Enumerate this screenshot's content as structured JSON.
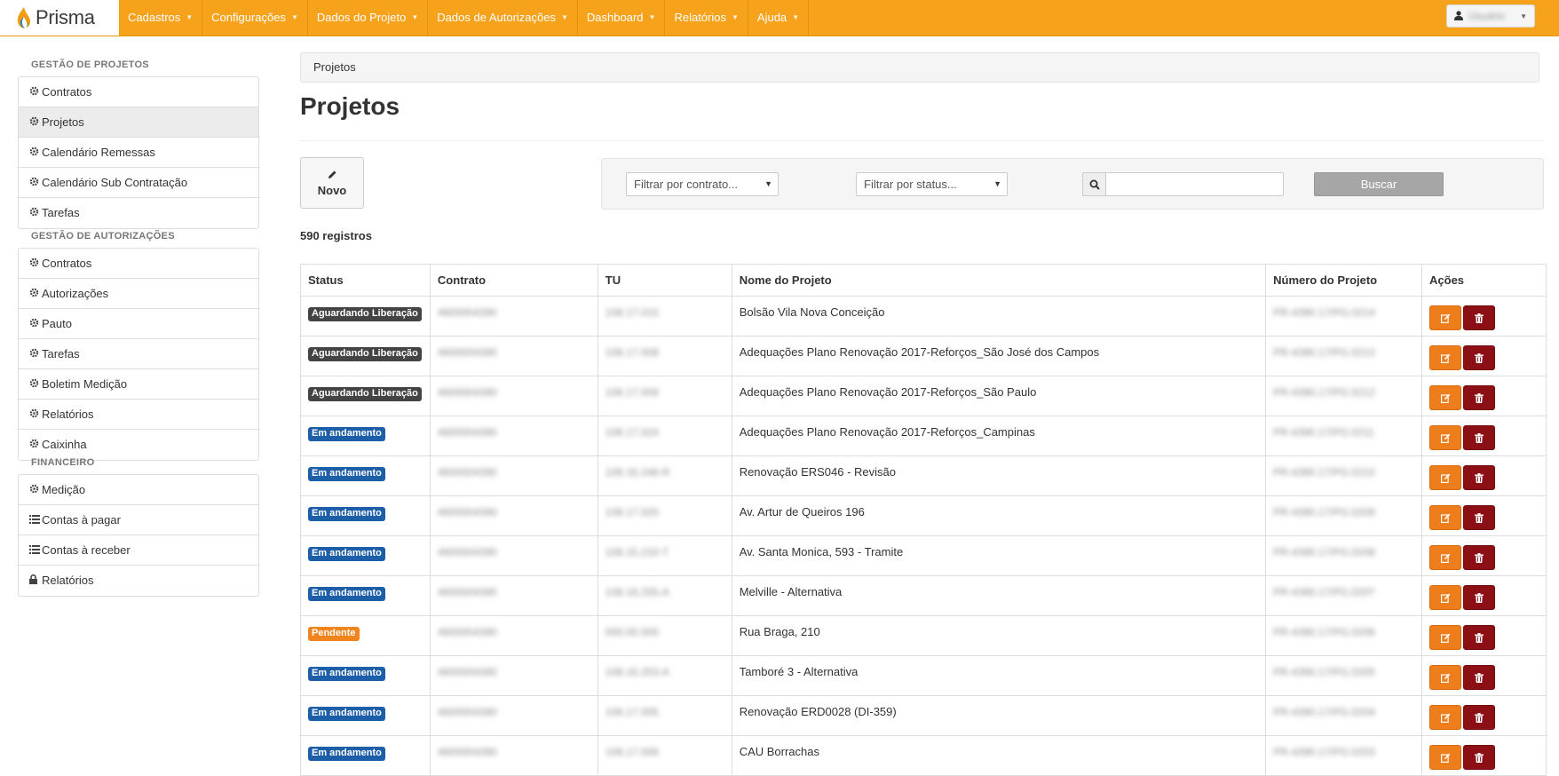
{
  "brand": {
    "name": "Prisma"
  },
  "nav": [
    {
      "label": "Cadastros"
    },
    {
      "label": "Configurações"
    },
    {
      "label": "Dados do Projeto"
    },
    {
      "label": "Dados de Autorizações"
    },
    {
      "label": "Dashboard"
    },
    {
      "label": "Relatórios"
    },
    {
      "label": "Ajuda"
    }
  ],
  "user": {
    "name": "Usuário"
  },
  "sidebar": {
    "sections": [
      {
        "title": "GESTÃO DE PROJETOS",
        "items": [
          {
            "label": "Contratos",
            "icon": "gear-icon"
          },
          {
            "label": "Projetos",
            "icon": "gear-icon"
          },
          {
            "label": "Calendário Remessas",
            "icon": "gear-icon"
          },
          {
            "label": "Calendário Sub Contratação",
            "icon": "gear-icon"
          },
          {
            "label": "Tarefas",
            "icon": "gear-icon"
          }
        ]
      },
      {
        "title": "GESTÃO DE AUTORIZAÇÕES",
        "items": [
          {
            "label": "Contratos",
            "icon": "gear-icon"
          },
          {
            "label": "Autorizações",
            "icon": "gear-icon"
          },
          {
            "label": "Pauto",
            "icon": "gear-icon"
          },
          {
            "label": "Tarefas",
            "icon": "gear-icon"
          },
          {
            "label": "Boletim Medição",
            "icon": "gear-icon"
          },
          {
            "label": "Relatórios",
            "icon": "gear-icon"
          },
          {
            "label": "Caixinha",
            "icon": "gear-icon"
          }
        ]
      },
      {
        "title": "FINANCEIRO",
        "items": [
          {
            "label": "Medição",
            "icon": "gear-icon"
          },
          {
            "label": "Contas à pagar",
            "icon": "list-icon"
          },
          {
            "label": "Contas à receber",
            "icon": "list-icon"
          },
          {
            "label": "Relatórios",
            "icon": "lock-icon"
          }
        ]
      }
    ],
    "active": "Projetos"
  },
  "breadcrumb": "Projetos",
  "page_title": "Projetos",
  "toolbar": {
    "new_label": "Novo"
  },
  "filters": {
    "contract_placeholder": "Filtrar por contrato...",
    "status_placeholder": "Filtrar por status...",
    "search_value": "",
    "search_button": "Buscar"
  },
  "record_count": "590 registros",
  "table": {
    "headers": [
      "Status",
      "Contrato",
      "TU",
      "Nome do Projeto",
      "Número do Projeto",
      "Ações"
    ],
    "rows": [
      {
        "status": "Aguardando Liberação",
        "contrato": "4600004390",
        "tu": "106.17.015",
        "nome": "Bolsão Vila Nova Conceição",
        "numero": "PR-4390.17/PG.0214"
      },
      {
        "status": "Aguardando Liberação",
        "contrato": "4600004390",
        "tu": "106.17.008",
        "nome": "Adequações Plano Renovação 2017-Reforços_São José dos Campos",
        "numero": "PR-4390.17/PG.0213"
      },
      {
        "status": "Aguardando Liberação",
        "contrato": "4600004390",
        "tu": "106.17.009",
        "nome": "Adequações Plano Renovação 2017-Reforços_São Paulo",
        "numero": "PR-4390.17/PG.0212"
      },
      {
        "status": "Em andamento",
        "contrato": "4600004390",
        "tu": "106.17.024",
        "nome": "Adequações Plano Renovação 2017-Reforços_Campinas",
        "numero": "PR-4390.17/PG.0211"
      },
      {
        "status": "Em andamento",
        "contrato": "4600004390",
        "tu": "106.16.246-R",
        "nome": "Renovação ERS046 - Revisão",
        "numero": "PR-4390.17/PG.0210"
      },
      {
        "status": "Em andamento",
        "contrato": "4600004390",
        "tu": "106.17.020",
        "nome": "Av. Artur de Queiros 196",
        "numero": "PR-4390.17/PG.0209"
      },
      {
        "status": "Em andamento",
        "contrato": "4600004390",
        "tu": "106.15.233-T",
        "nome": "Av. Santa Monica, 593 - Tramite",
        "numero": "PR-4390.17/PG.0208"
      },
      {
        "status": "Em andamento",
        "contrato": "4600004390",
        "tu": "106.16.255-A",
        "nome": "Melville - Alternativa",
        "numero": "PR-4390.17/PG.0207"
      },
      {
        "status": "Pendente",
        "contrato": "4600004390",
        "tu": "000.00.000",
        "nome": "Rua Braga, 210",
        "numero": "PR-4390.17/PG.0206"
      },
      {
        "status": "Em andamento",
        "contrato": "4600004390",
        "tu": "106.16.253-A",
        "nome": "Tamboré 3 - Alternativa",
        "numero": "PR-4390.17/PG.0205"
      },
      {
        "status": "Em andamento",
        "contrato": "4600004390",
        "tu": "106.17.005",
        "nome": "Renovação ERD0028 (DI-359)",
        "numero": "PR-4390.17/PG.0204"
      },
      {
        "status": "Em andamento",
        "contrato": "4600004390",
        "tu": "106.17.006",
        "nome": "CAU Borrachas",
        "numero": "PR-4390.17/PG.0203"
      }
    ]
  },
  "status_colors": {
    "Aguardando Liberação": "#444444",
    "Em andamento": "#1c5ea8",
    "Pendente": "#f0841d"
  },
  "colors": {
    "nav": "#f7a21b",
    "edit": "#ee7d1b",
    "delete": "#8b0f14"
  }
}
